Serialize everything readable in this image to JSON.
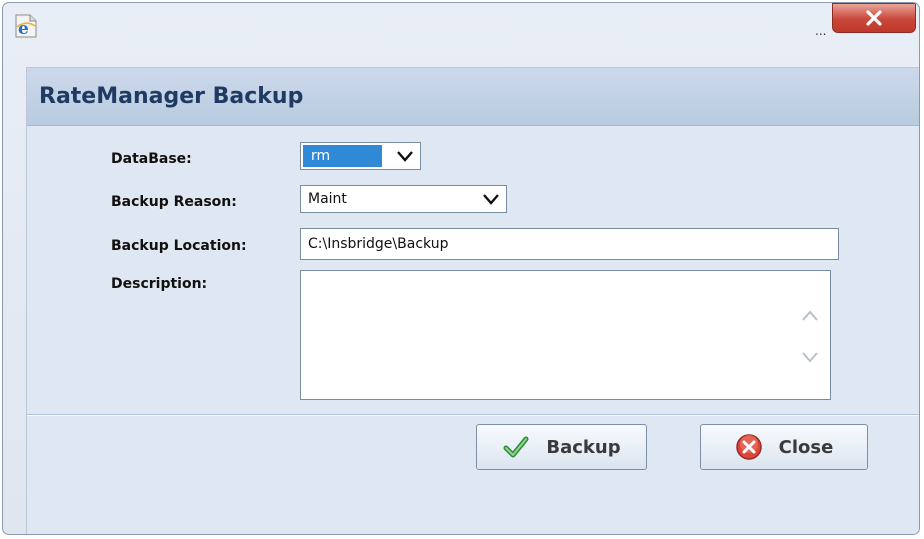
{
  "titlebar": {
    "ellipsis": "...",
    "close_glyph": "X"
  },
  "dialog": {
    "title": "RateManager Backup"
  },
  "form": {
    "database": {
      "label": "DataBase:",
      "value": "rm"
    },
    "backup_reason": {
      "label": "Backup Reason:",
      "value": "Maint"
    },
    "backup_location": {
      "label": "Backup Location:",
      "value": "C:\\Insbridge\\Backup"
    },
    "description": {
      "label": "Description:",
      "value": ""
    }
  },
  "buttons": {
    "backup_label": "Backup",
    "close_label": "Close"
  },
  "icons": {
    "app": "ie-icon",
    "backup": "checkmark-icon",
    "close": "close-circle-icon"
  },
  "colors": {
    "selection": "#2f89d6",
    "close_x_bg": "#c9463a",
    "header_title": "#1f3b63"
  }
}
